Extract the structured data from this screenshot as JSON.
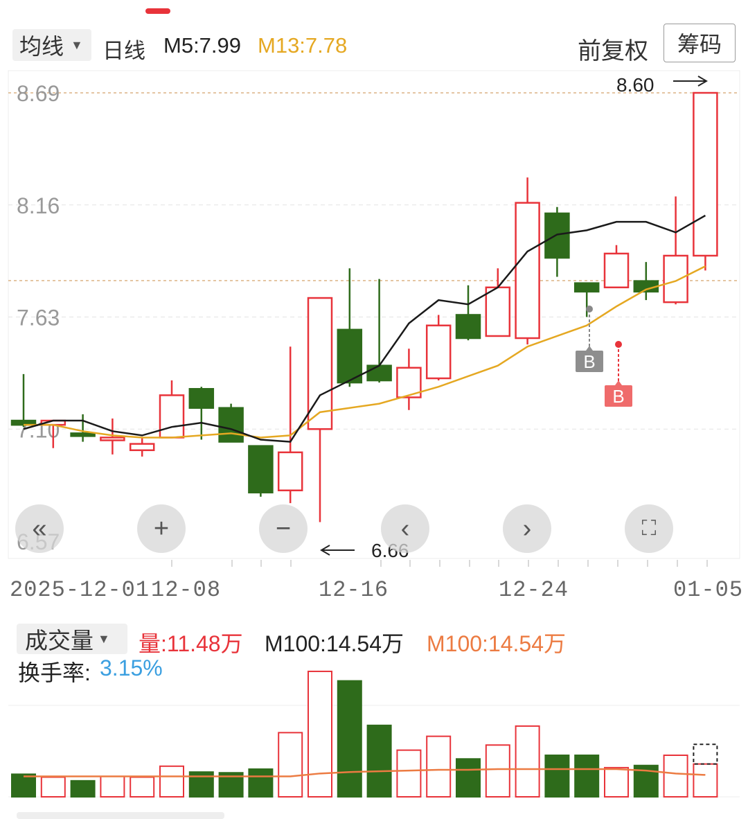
{
  "header": {
    "indicator_label": "均线",
    "period_label": "日线",
    "m5": "M5:7.99",
    "m13": "M13:7.78",
    "adjust_label": "前复权",
    "chips_label": "筹码"
  },
  "colors": {
    "up": "#e8333a",
    "down": "#2e6b1b",
    "m5_line": "#1a1a1a",
    "m13_line": "#e5a822",
    "vol_ma": "#ec7b42",
    "turnover": "#3b9fe0"
  },
  "price_axis": {
    "labels": [
      "8.69",
      "8.16",
      "7.63",
      "7.10",
      "6.57"
    ]
  },
  "markers": {
    "high": "8.60",
    "low": "6.66",
    "buy_label": "B"
  },
  "controls": {
    "rewind": "«",
    "zoom_in": "+",
    "zoom_out": "−",
    "prev": "‹",
    "next": "›",
    "fullscreen": "⛶"
  },
  "date_axis": {
    "labels": [
      "2025-12-01",
      "12-08",
      "12-16",
      "12-24",
      "01-05"
    ]
  },
  "volume": {
    "indicator_label": "成交量",
    "vol": "量:11.48万",
    "ma_black": "M100:14.54万",
    "ma_orange": "M100:14.54万",
    "turnover_label": "换手率:",
    "turnover_value": "3.15%"
  },
  "chart_data": {
    "type": "candlestick",
    "ylim": [
      6.57,
      8.69
    ],
    "candles": [
      {
        "o": 7.14,
        "c": 7.12,
        "h": 7.36,
        "l": 7.11
      },
      {
        "o": 7.12,
        "c": 7.14,
        "h": 7.14,
        "l": 7.01
      },
      {
        "o": 7.08,
        "c": 7.07,
        "h": 7.17,
        "l": 7.04
      },
      {
        "o": 7.05,
        "c": 7.06,
        "h": 7.15,
        "l": 6.98
      },
      {
        "o": 7.0,
        "c": 7.03,
        "h": 7.06,
        "l": 6.97
      },
      {
        "o": 7.06,
        "c": 7.26,
        "h": 7.33,
        "l": 7.06
      },
      {
        "o": 7.29,
        "c": 7.2,
        "h": 7.3,
        "l": 7.05
      },
      {
        "o": 7.2,
        "c": 7.04,
        "h": 7.22,
        "l": 7.04
      },
      {
        "o": 7.02,
        "c": 6.8,
        "h": 7.02,
        "l": 6.78
      },
      {
        "o": 6.81,
        "c": 6.99,
        "h": 7.49,
        "l": 6.75
      },
      {
        "o": 7.1,
        "c": 7.72,
        "h": 7.72,
        "l": 6.66
      },
      {
        "o": 7.57,
        "c": 7.32,
        "h": 7.86,
        "l": 7.3
      },
      {
        "o": 7.4,
        "c": 7.33,
        "h": 7.81,
        "l": 7.32
      },
      {
        "o": 7.25,
        "c": 7.39,
        "h": 7.48,
        "l": 7.19
      },
      {
        "o": 7.34,
        "c": 7.59,
        "h": 7.64,
        "l": 7.33
      },
      {
        "o": 7.64,
        "c": 7.53,
        "h": 7.78,
        "l": 7.52
      },
      {
        "o": 7.54,
        "c": 7.77,
        "h": 7.86,
        "l": 7.54
      },
      {
        "o": 7.53,
        "c": 8.17,
        "h": 8.29,
        "l": 7.5
      },
      {
        "o": 8.12,
        "c": 7.91,
        "h": 8.15,
        "l": 7.82
      },
      {
        "o": 7.79,
        "c": 7.75,
        "h": 7.79,
        "l": 7.63
      },
      {
        "o": 7.77,
        "c": 7.93,
        "h": 7.97,
        "l": 7.77
      },
      {
        "o": 7.8,
        "c": 7.75,
        "h": 7.89,
        "l": 7.71
      },
      {
        "o": 7.7,
        "c": 7.92,
        "h": 8.2,
        "l": 7.69
      },
      {
        "o": 7.92,
        "c": 8.69,
        "h": 8.69,
        "l": 7.85
      }
    ],
    "m5": [
      7.1,
      7.14,
      7.14,
      7.09,
      7.07,
      7.11,
      7.13,
      7.1,
      7.05,
      7.04,
      7.26,
      7.33,
      7.4,
      7.6,
      7.71,
      7.69,
      7.77,
      7.94,
      8.02,
      8.04,
      8.08,
      8.08,
      8.03,
      8.11
    ],
    "m13": [
      7.12,
      7.12,
      7.09,
      7.07,
      7.06,
      7.06,
      7.07,
      7.08,
      7.06,
      7.07,
      7.18,
      7.2,
      7.22,
      7.26,
      7.3,
      7.35,
      7.4,
      7.49,
      7.54,
      7.59,
      7.68,
      7.76,
      7.8,
      7.87
    ],
    "volume_series": [
      {
        "v": 3.1,
        "up": false
      },
      {
        "v": 2.7,
        "up": true
      },
      {
        "v": 2.2,
        "up": false
      },
      {
        "v": 2.8,
        "up": true
      },
      {
        "v": 2.7,
        "up": true
      },
      {
        "v": 4.2,
        "up": true
      },
      {
        "v": 3.4,
        "up": false
      },
      {
        "v": 3.3,
        "up": false
      },
      {
        "v": 3.8,
        "up": false
      },
      {
        "v": 8.8,
        "up": true
      },
      {
        "v": 17.2,
        "up": true
      },
      {
        "v": 15.9,
        "up": false
      },
      {
        "v": 9.8,
        "up": false
      },
      {
        "v": 6.4,
        "up": true
      },
      {
        "v": 8.3,
        "up": true
      },
      {
        "v": 5.2,
        "up": false
      },
      {
        "v": 7.1,
        "up": true
      },
      {
        "v": 9.7,
        "up": true
      },
      {
        "v": 5.7,
        "up": false
      },
      {
        "v": 5.7,
        "up": false
      },
      {
        "v": 4.0,
        "up": true
      },
      {
        "v": 4.3,
        "up": false
      },
      {
        "v": 5.7,
        "up": true
      },
      {
        "v": 4.5,
        "up": true
      }
    ],
    "vol_ma": [
      2.8,
      2.8,
      2.8,
      2.8,
      2.8,
      2.8,
      2.8,
      2.8,
      2.8,
      2.8,
      3.2,
      3.4,
      3.5,
      3.6,
      3.7,
      3.7,
      3.8,
      3.8,
      3.8,
      3.8,
      3.8,
      3.6,
      3.2,
      3.0
    ]
  }
}
